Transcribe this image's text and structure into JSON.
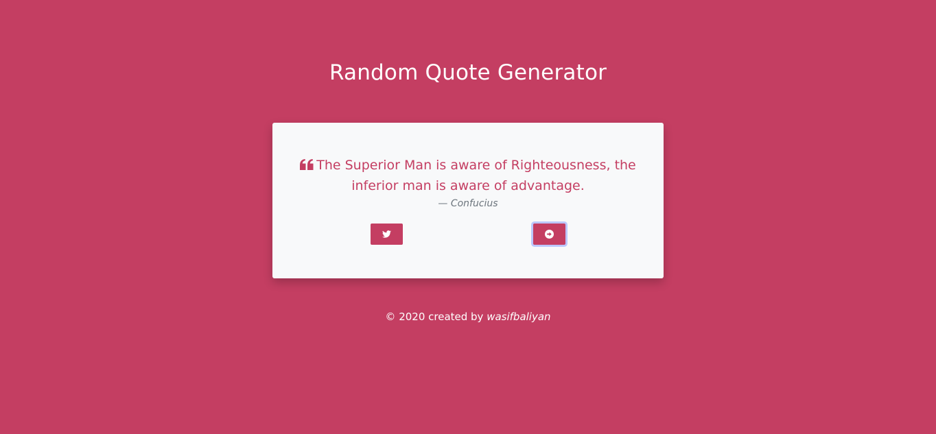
{
  "page": {
    "title": "Random Quote Generator",
    "background_color": "#c43e62"
  },
  "quote": {
    "text": "The Superior Man is aware of Righteousness, the inferior man is aware of advantage.",
    "dash": "— ",
    "author": "Confucius",
    "icon": "quote-left-icon",
    "accent_color": "#c43e62",
    "card_color": "#f8f9fa"
  },
  "buttons": {
    "tweet_icon": "twitter-icon",
    "next_icon": "arrow-circle-right-icon"
  },
  "footer": {
    "prefix": "© 2020 created by ",
    "author": "wasifbaliyan"
  }
}
